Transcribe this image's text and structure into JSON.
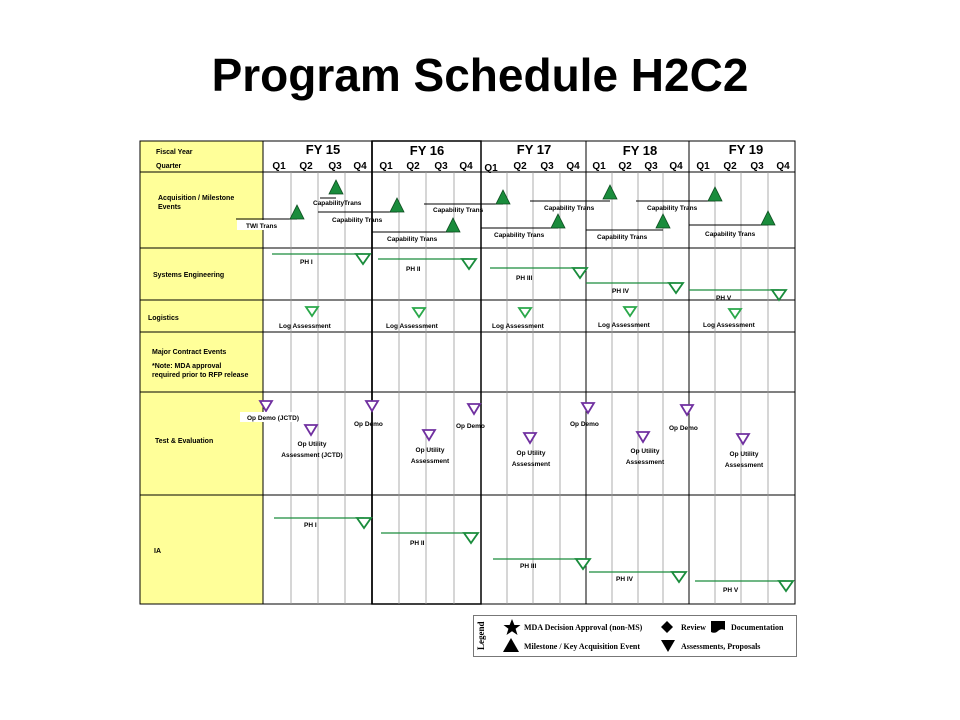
{
  "title": "Program Schedule H2C2",
  "header": {
    "fiscal_year_label": "Fiscal Year",
    "quarter_label": "Quarter"
  },
  "fiscal_years": [
    "FY 15",
    "FY 16",
    "FY 17",
    "FY 18",
    "FY 19"
  ],
  "quarters": [
    [
      "Q1",
      "Q2",
      "Q3",
      "Q4"
    ],
    [
      "Q1",
      "Q2",
      "Q3",
      "Q4"
    ],
    [
      "Q1",
      "Q2",
      "Q3",
      "Q4"
    ],
    [
      "Q1",
      "Q2",
      "Q3",
      "Q4"
    ],
    [
      "Q1",
      "Q2",
      "Q3",
      "Q4"
    ]
  ],
  "rows": {
    "acquisition": [
      "Acquisition / Milestone",
      "Events"
    ],
    "systems_engineering": "Systems Engineering",
    "logistics": "Logistics",
    "major_contract": "Major Contract Events",
    "major_contract_note": [
      "*Note: MDA approval",
      "required prior to RFP release"
    ],
    "test_eval": "Test & Evaluation",
    "ia": "IA"
  },
  "acquisition_labels": {
    "twi_trans": "TWI Trans",
    "capability_trans_a": "CapabilityTrans",
    "capability_trans": "Capability  Trans"
  },
  "systems_engineering_phases": [
    "PH I",
    "PH II",
    "PH III",
    "PH IV",
    "PH V"
  ],
  "logistics_label": "Log Assessment",
  "test_eval_labels": {
    "op_demo_jctd": "Op Demo  (JCTD)",
    "op_demo": "Op Demo",
    "op_utility_jctd": [
      "Op Utility",
      "Assessment (JCTD)"
    ],
    "op_utility": [
      "Op Utility",
      "Assessment"
    ]
  },
  "ia_phases": [
    "PH I",
    "PH II",
    "PH III",
    "PH IV",
    "PH V"
  ],
  "legend": {
    "word": "Legend",
    "items": {
      "mda": "MDA Decision Approval (non-MS)",
      "review": "Review",
      "documentation": "Documentation",
      "milestone": "Milestone / Key Acquisition Event",
      "assessments": "Assessments, Proposals"
    }
  },
  "colors": {
    "label_column": "#ffff99",
    "milestone_green": "#1a8c3c",
    "assessment_green": "#2aa84a",
    "test_purple": "#7030a0",
    "grid_line": "#999999",
    "text": "#000000"
  }
}
